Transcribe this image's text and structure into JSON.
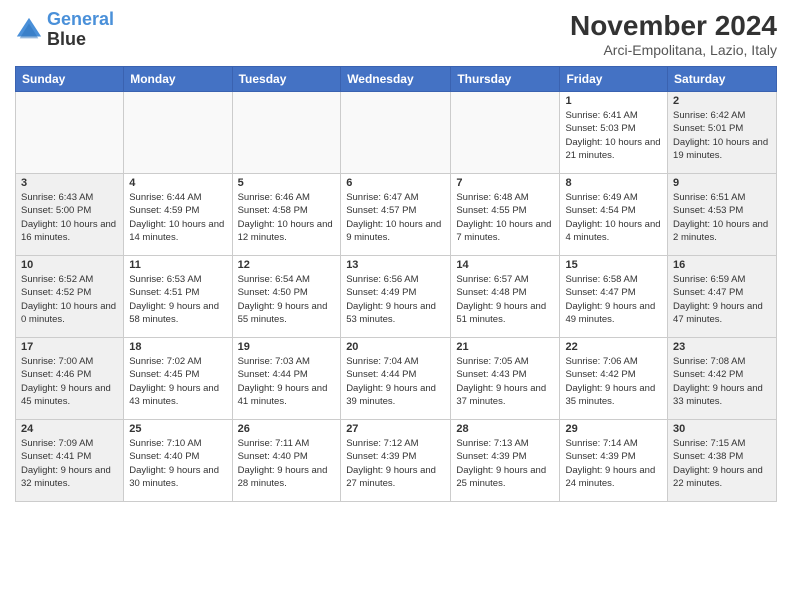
{
  "header": {
    "logo_line1": "General",
    "logo_line2": "Blue",
    "month_title": "November 2024",
    "location": "Arci-Empolitana, Lazio, Italy"
  },
  "weekdays": [
    "Sunday",
    "Monday",
    "Tuesday",
    "Wednesday",
    "Thursday",
    "Friday",
    "Saturday"
  ],
  "weeks": [
    [
      {
        "day": "",
        "info": ""
      },
      {
        "day": "",
        "info": ""
      },
      {
        "day": "",
        "info": ""
      },
      {
        "day": "",
        "info": ""
      },
      {
        "day": "",
        "info": ""
      },
      {
        "day": "1",
        "info": "Sunrise: 6:41 AM\nSunset: 5:03 PM\nDaylight: 10 hours and 21 minutes."
      },
      {
        "day": "2",
        "info": "Sunrise: 6:42 AM\nSunset: 5:01 PM\nDaylight: 10 hours and 19 minutes."
      }
    ],
    [
      {
        "day": "3",
        "info": "Sunrise: 6:43 AM\nSunset: 5:00 PM\nDaylight: 10 hours and 16 minutes."
      },
      {
        "day": "4",
        "info": "Sunrise: 6:44 AM\nSunset: 4:59 PM\nDaylight: 10 hours and 14 minutes."
      },
      {
        "day": "5",
        "info": "Sunrise: 6:46 AM\nSunset: 4:58 PM\nDaylight: 10 hours and 12 minutes."
      },
      {
        "day": "6",
        "info": "Sunrise: 6:47 AM\nSunset: 4:57 PM\nDaylight: 10 hours and 9 minutes."
      },
      {
        "day": "7",
        "info": "Sunrise: 6:48 AM\nSunset: 4:55 PM\nDaylight: 10 hours and 7 minutes."
      },
      {
        "day": "8",
        "info": "Sunrise: 6:49 AM\nSunset: 4:54 PM\nDaylight: 10 hours and 4 minutes."
      },
      {
        "day": "9",
        "info": "Sunrise: 6:51 AM\nSunset: 4:53 PM\nDaylight: 10 hours and 2 minutes."
      }
    ],
    [
      {
        "day": "10",
        "info": "Sunrise: 6:52 AM\nSunset: 4:52 PM\nDaylight: 10 hours and 0 minutes."
      },
      {
        "day": "11",
        "info": "Sunrise: 6:53 AM\nSunset: 4:51 PM\nDaylight: 9 hours and 58 minutes."
      },
      {
        "day": "12",
        "info": "Sunrise: 6:54 AM\nSunset: 4:50 PM\nDaylight: 9 hours and 55 minutes."
      },
      {
        "day": "13",
        "info": "Sunrise: 6:56 AM\nSunset: 4:49 PM\nDaylight: 9 hours and 53 minutes."
      },
      {
        "day": "14",
        "info": "Sunrise: 6:57 AM\nSunset: 4:48 PM\nDaylight: 9 hours and 51 minutes."
      },
      {
        "day": "15",
        "info": "Sunrise: 6:58 AM\nSunset: 4:47 PM\nDaylight: 9 hours and 49 minutes."
      },
      {
        "day": "16",
        "info": "Sunrise: 6:59 AM\nSunset: 4:47 PM\nDaylight: 9 hours and 47 minutes."
      }
    ],
    [
      {
        "day": "17",
        "info": "Sunrise: 7:00 AM\nSunset: 4:46 PM\nDaylight: 9 hours and 45 minutes."
      },
      {
        "day": "18",
        "info": "Sunrise: 7:02 AM\nSunset: 4:45 PM\nDaylight: 9 hours and 43 minutes."
      },
      {
        "day": "19",
        "info": "Sunrise: 7:03 AM\nSunset: 4:44 PM\nDaylight: 9 hours and 41 minutes."
      },
      {
        "day": "20",
        "info": "Sunrise: 7:04 AM\nSunset: 4:44 PM\nDaylight: 9 hours and 39 minutes."
      },
      {
        "day": "21",
        "info": "Sunrise: 7:05 AM\nSunset: 4:43 PM\nDaylight: 9 hours and 37 minutes."
      },
      {
        "day": "22",
        "info": "Sunrise: 7:06 AM\nSunset: 4:42 PM\nDaylight: 9 hours and 35 minutes."
      },
      {
        "day": "23",
        "info": "Sunrise: 7:08 AM\nSunset: 4:42 PM\nDaylight: 9 hours and 33 minutes."
      }
    ],
    [
      {
        "day": "24",
        "info": "Sunrise: 7:09 AM\nSunset: 4:41 PM\nDaylight: 9 hours and 32 minutes."
      },
      {
        "day": "25",
        "info": "Sunrise: 7:10 AM\nSunset: 4:40 PM\nDaylight: 9 hours and 30 minutes."
      },
      {
        "day": "26",
        "info": "Sunrise: 7:11 AM\nSunset: 4:40 PM\nDaylight: 9 hours and 28 minutes."
      },
      {
        "day": "27",
        "info": "Sunrise: 7:12 AM\nSunset: 4:39 PM\nDaylight: 9 hours and 27 minutes."
      },
      {
        "day": "28",
        "info": "Sunrise: 7:13 AM\nSunset: 4:39 PM\nDaylight: 9 hours and 25 minutes."
      },
      {
        "day": "29",
        "info": "Sunrise: 7:14 AM\nSunset: 4:39 PM\nDaylight: 9 hours and 24 minutes."
      },
      {
        "day": "30",
        "info": "Sunrise: 7:15 AM\nSunset: 4:38 PM\nDaylight: 9 hours and 22 minutes."
      }
    ]
  ]
}
